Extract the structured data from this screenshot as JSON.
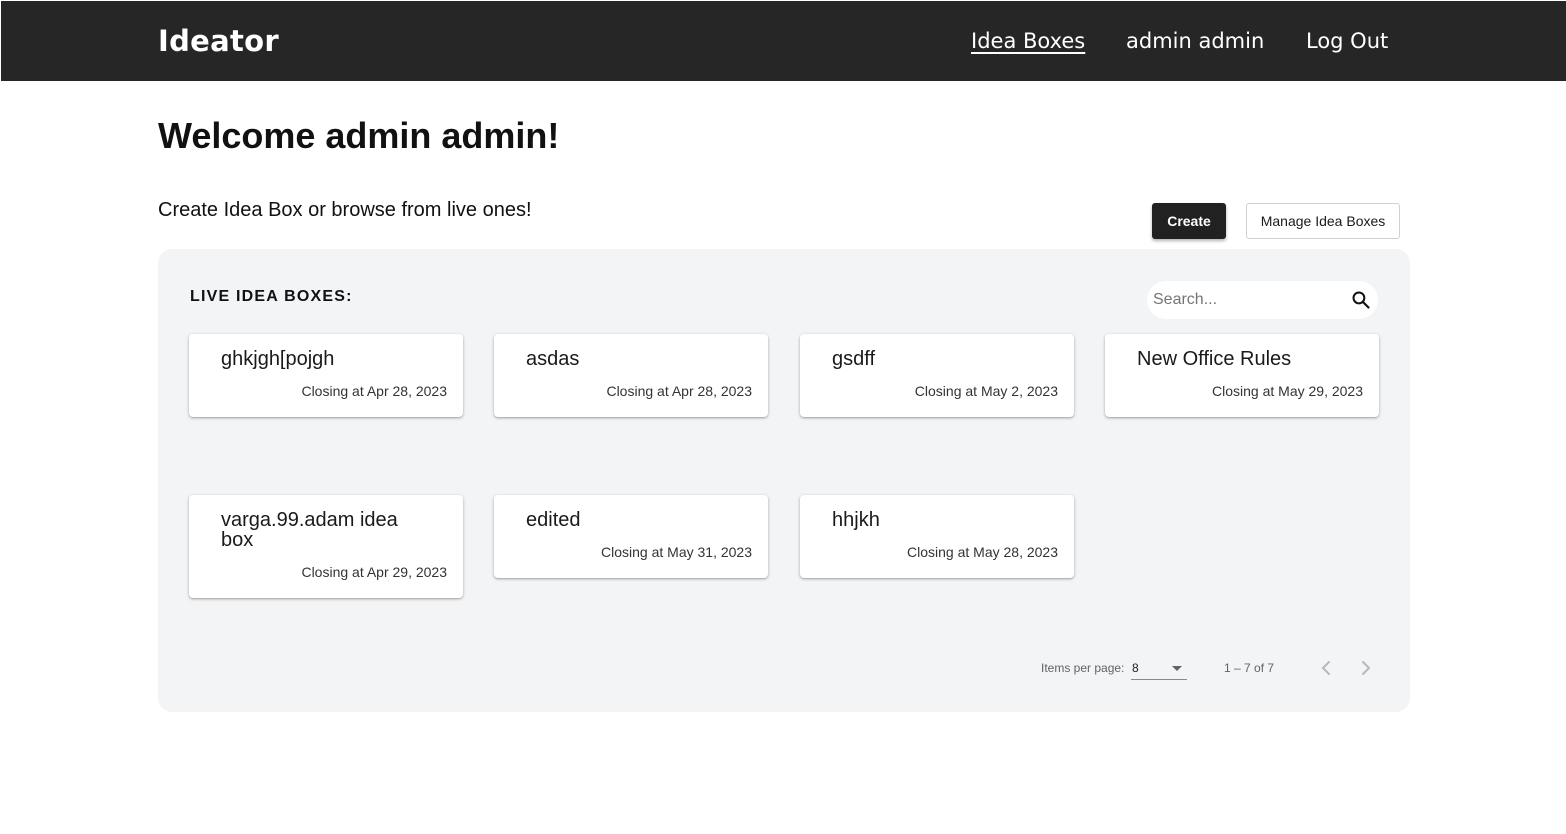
{
  "app": {
    "brand": "Ideator"
  },
  "nav": {
    "items": [
      {
        "label": "Idea Boxes",
        "active": true
      },
      {
        "label": "admin admin",
        "active": false
      },
      {
        "label": "Log Out",
        "active": false
      }
    ]
  },
  "page": {
    "welcome": "Welcome admin admin!",
    "subtitle": "Create Idea Box or browse from live ones!",
    "create_label": "Create",
    "manage_label": "Manage Idea Boxes"
  },
  "live": {
    "title": "LIVE IDEA BOXES:",
    "search_placeholder": "Search...",
    "search_value": "",
    "cards": [
      {
        "title": "ghkjgh[pojgh",
        "date": "Closing at Apr 28, 2023"
      },
      {
        "title": "asdas",
        "date": "Closing at Apr 28, 2023"
      },
      {
        "title": "gsdff",
        "date": "Closing at May 2, 2023"
      },
      {
        "title": "New Office Rules",
        "date": "Closing at May 29, 2023"
      },
      {
        "title": "varga.99.adam idea box",
        "date": "Closing at Apr 29, 2023"
      },
      {
        "title": "edited",
        "date": "Closing at May 31, 2023"
      },
      {
        "title": "hhjkh",
        "date": "Closing at May 28, 2023"
      }
    ]
  },
  "paginator": {
    "items_per_page_label": "Items per page:",
    "items_per_page_value": "8",
    "range_label": "1 – 7 of 7",
    "prev_icon": "chevron-left-icon",
    "next_icon": "chevron-right-icon"
  },
  "colors": {
    "header_bg": "#262626",
    "panel_bg": "#f3f4f6",
    "primary_button": "#212121"
  }
}
